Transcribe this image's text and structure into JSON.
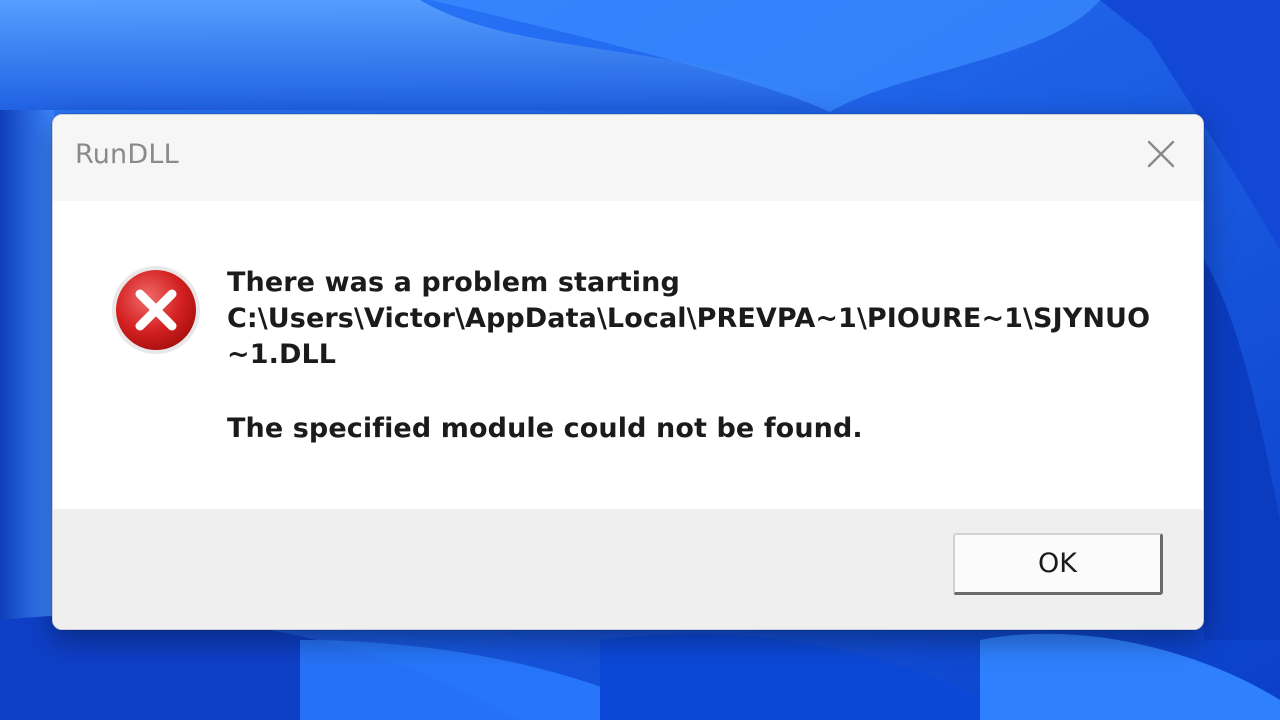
{
  "dialog": {
    "title": "RunDLL",
    "message_line1": "There was a problem starting",
    "message_path": "C:\\Users\\Victor\\AppData\\Local\\PREVPA~1\\PIOURE~1\\SJYNUO~1.DLL",
    "message_detail": "The specified module could not be found.",
    "ok_label": "OK"
  },
  "icons": {
    "close": "close-icon",
    "error": "error-icon"
  },
  "colors": {
    "wallpaper_blue": "#1f5fe0",
    "error_red": "#d42020",
    "title_gray": "#8a8a8a"
  }
}
